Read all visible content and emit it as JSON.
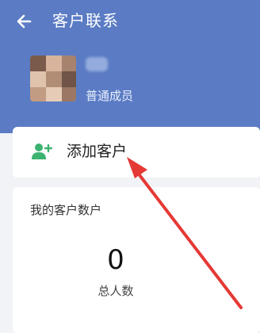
{
  "header": {
    "title": "客户联系",
    "back_icon": "arrow-left-icon",
    "background_color": "#5b7cc4"
  },
  "profile": {
    "role": "普通成员"
  },
  "actions": {
    "add_customer_label": "添加客户",
    "add_customer_icon": "add-user-icon",
    "icon_color": "#3cb371"
  },
  "stats": {
    "title": "我的客户数户",
    "total_value": "0",
    "total_label": "总人数"
  },
  "annotation": {
    "arrow_color": "#e53935"
  }
}
